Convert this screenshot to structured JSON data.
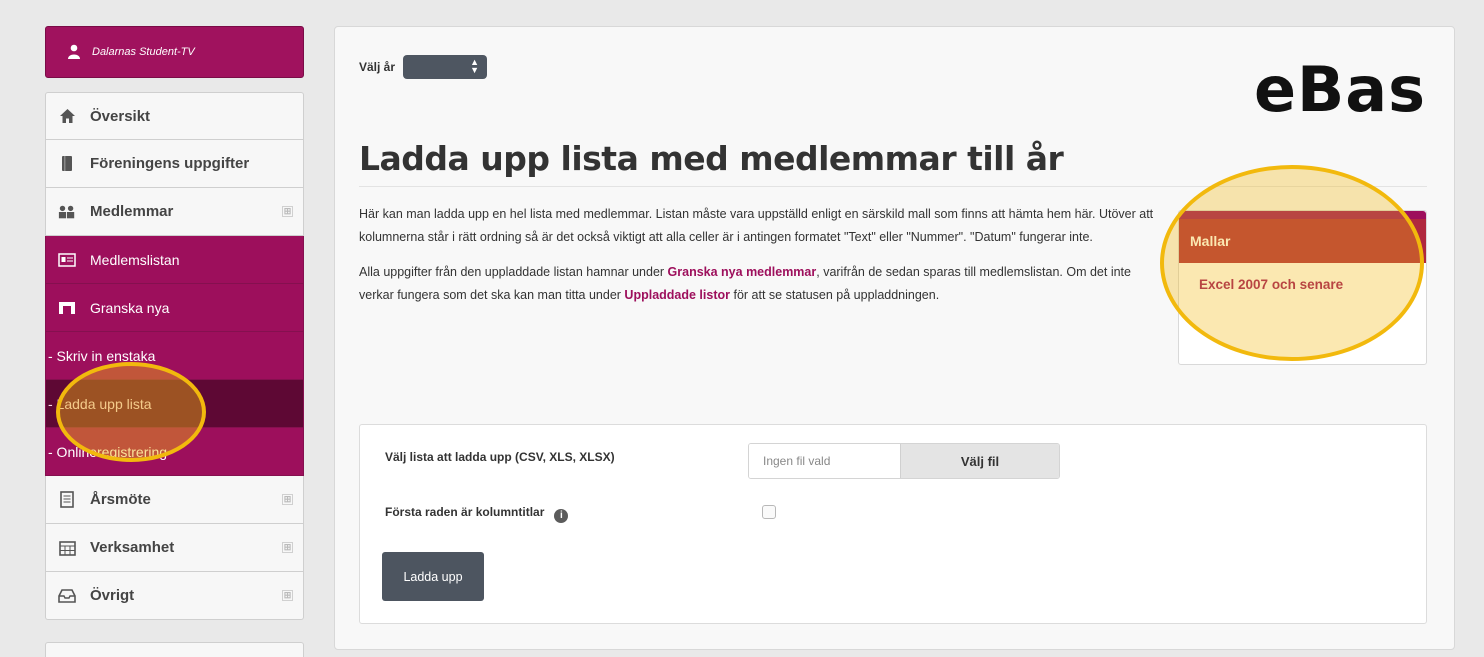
{
  "sidebar": {
    "org_name": "Dalarnas Student-TV",
    "items": [
      {
        "label": "Översikt",
        "icon": "home-icon"
      },
      {
        "label": "Föreningens uppgifter",
        "icon": "book-icon"
      },
      {
        "label": "Medlemmar",
        "icon": "users-icon"
      },
      {
        "label": "Medlemslistan",
        "icon": "list-card-icon"
      },
      {
        "label": "Granska nya",
        "icon": "inbox-icon"
      },
      {
        "label": "- Skriv in enstaka"
      },
      {
        "label": "- Ladda upp lista"
      },
      {
        "label": "- Onlineregistrering"
      },
      {
        "label": "Årsmöte",
        "icon": "document-icon"
      },
      {
        "label": "Verksamhet",
        "icon": "calendar-icon"
      },
      {
        "label": "Övrigt",
        "icon": "tray-icon"
      }
    ],
    "expand_symbol": "⊞"
  },
  "header": {
    "year_label": "Välj år",
    "brand": "eBas"
  },
  "main": {
    "title": "Ladda upp lista med medlemmar till år",
    "para1": "Här kan man ladda upp en hel lista med medlemmar. Listan måste vara uppställd enligt en särskild mall som finns att hämta hem här. Utöver att kolumnerna står i rätt ordning så är det också viktigt att alla celler är i antingen formatet \"Text\" eller \"Nummer\". \"Datum\" fungerar inte.",
    "para2_a": "Alla uppgifter från den uppladdade listan hamnar under ",
    "para2_link1": "Granska nya medlemmar",
    "para2_b": ", varifrån de sedan sparas till medlemslistan. Om det inte verkar fungera som det ska kan man titta under ",
    "para2_link2": "Uppladdade listor",
    "para2_c": " för att se statusen på uppladdningen."
  },
  "templates": {
    "heading": "Mallar",
    "link": "Excel 2007 och senare"
  },
  "upload_form": {
    "file_label": "Välj lista att ladda upp (CSV, XLS, XLSX)",
    "file_placeholder": "Ingen fil vald",
    "choose_button": "Välj fil",
    "header_row_label": "Första raden är kolumntitlar",
    "info_symbol": "i",
    "header_row_checked": false,
    "submit_label": "Ladda upp"
  },
  "colors": {
    "brand_purple": "#9d0f5c",
    "active_dark": "#5e0834",
    "templates_red": "#b0283e",
    "highlight_yellow": "#f2b90d",
    "button_dark": "#4d5560"
  }
}
